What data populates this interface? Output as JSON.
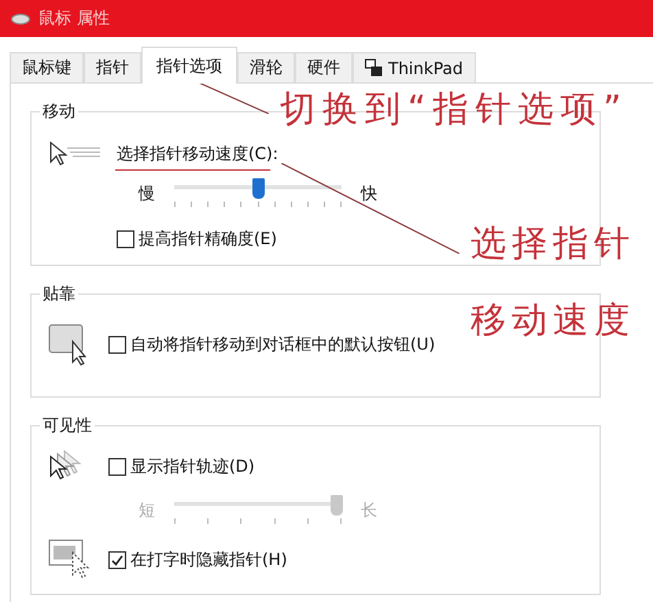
{
  "window": {
    "title": "鼠标 属性"
  },
  "tabs": [
    {
      "label": "鼠标键",
      "selected": false
    },
    {
      "label": "指针",
      "selected": false
    },
    {
      "label": "指针选项",
      "selected": true
    },
    {
      "label": "滑轮",
      "selected": false
    },
    {
      "label": "硬件",
      "selected": false
    },
    {
      "label": "ThinkPad",
      "selected": false,
      "kind": "icon"
    }
  ],
  "motion": {
    "title": "移动",
    "speed_label": "选择指针移动速度(C):",
    "slow": "慢",
    "fast": "快",
    "speed": {
      "level": 0.5
    },
    "precision": {
      "label": "提高指针精确度(E)",
      "checked": false
    }
  },
  "snap": {
    "title": "贴靠",
    "option": {
      "label": "自动将指针移动到对话框中的默认按钮(U)",
      "checked": false
    }
  },
  "visibility": {
    "title": "可见性",
    "trails": {
      "label": "显示指针轨迹(D)",
      "checked": false
    },
    "short": "短",
    "long": "长",
    "trail_length": {
      "level": 0.97,
      "disabled": true
    },
    "hide_typing": {
      "label": "在打字时隐藏指针(H)",
      "checked": true
    }
  },
  "annotations": [
    {
      "text": "切换到“指针选项”"
    },
    {
      "text": "选择指针"
    },
    {
      "text": "移动速度"
    }
  ]
}
